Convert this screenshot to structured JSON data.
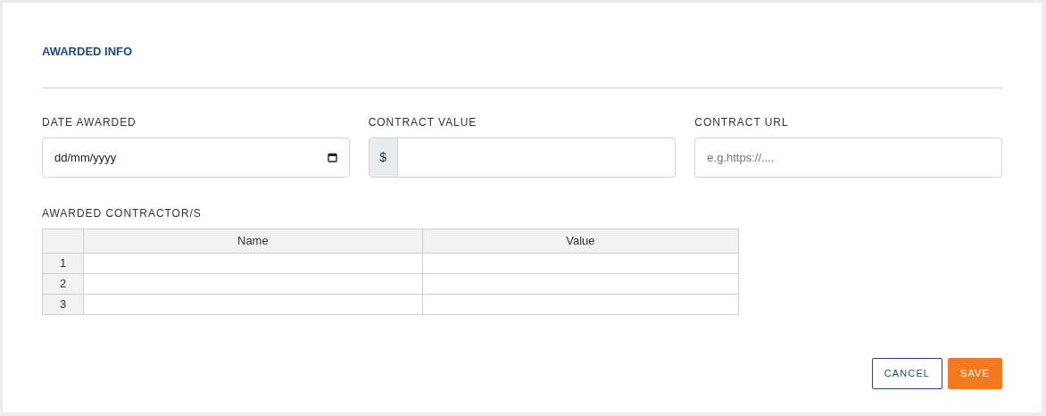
{
  "section": {
    "title": "AWARDED INFO"
  },
  "fields": [
    {
      "kind": "date",
      "label": "DATE AWARDED",
      "placeholder": "dd/mm/yyyy"
    },
    {
      "kind": "currency",
      "label": "CONTRACT VALUE",
      "prefix": "$"
    },
    {
      "kind": "text",
      "label": "CONTRACT URL",
      "placeholder": "e.g.https://...."
    }
  ],
  "table": {
    "label": "AWARDED CONTRACTOR/S",
    "columns": [
      "Name",
      "Value"
    ],
    "rows": [
      {
        "number": "1"
      },
      {
        "number": "2"
      },
      {
        "number": "3"
      }
    ]
  },
  "buttons": [
    {
      "kind": "secondary",
      "label": "CANCEL"
    },
    {
      "kind": "primary",
      "label": "SAVE"
    }
  ]
}
